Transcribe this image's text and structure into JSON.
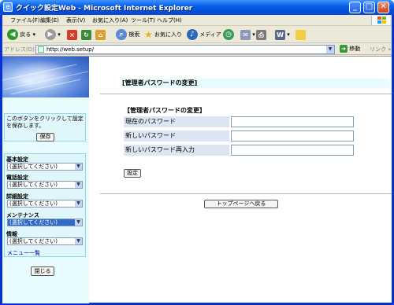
{
  "window": {
    "title": "クイック設定Web - Microsoft Internet Explorer",
    "minimize": "_",
    "maximize": "□",
    "close": "✕"
  },
  "menubar": {
    "items": [
      "ファイル(F)",
      "編集(E)",
      "表示(V)",
      "お気に入り(A)",
      "ツール(T)",
      "ヘルプ(H)"
    ]
  },
  "toolbar": {
    "back_label": "戻る",
    "search_label": "検索",
    "favorites_label": "お気に入り",
    "media_label": "メディア",
    "icons": [
      "back-icon",
      "forward-icon",
      "stop-icon",
      "refresh-icon",
      "home-icon",
      "search-icon",
      "favorites-icon",
      "media-icon",
      "history-icon",
      "mail-icon",
      "print-icon",
      "edit-icon",
      "discuss-icon"
    ]
  },
  "address": {
    "label": "アドレス(D)",
    "url": "http://web.setup/",
    "go_label": "移動",
    "links_label": "リンク »"
  },
  "sidebar": {
    "save_text": "このボタンをクリックして設定を保存します。",
    "save_button": "保存",
    "sections": [
      {
        "label": "基本設定",
        "value": "(選択してください)",
        "selected": false
      },
      {
        "label": "電話設定",
        "value": "(選択してください)",
        "selected": false
      },
      {
        "label": "詳細設定",
        "value": "(選択してください)",
        "selected": false
      },
      {
        "label": "メンテナンス",
        "value": "(選択してください)",
        "selected": true
      },
      {
        "label": "情報",
        "value": "(選択してください)",
        "selected": false
      }
    ],
    "menu_list_link": "メニュー一覧",
    "close_button": "閉じる"
  },
  "main": {
    "page_title": "[管理者パスワードの変更]",
    "section_title": "【管理者パスワードの変更】",
    "fields": [
      {
        "label": "現在のパスワード",
        "value": ""
      },
      {
        "label": "新しいパスワード",
        "value": ""
      },
      {
        "label": "新しいパスワード再入力",
        "value": ""
      }
    ],
    "submit_button": "設定",
    "top_page_button": "トップページへ戻る"
  }
}
